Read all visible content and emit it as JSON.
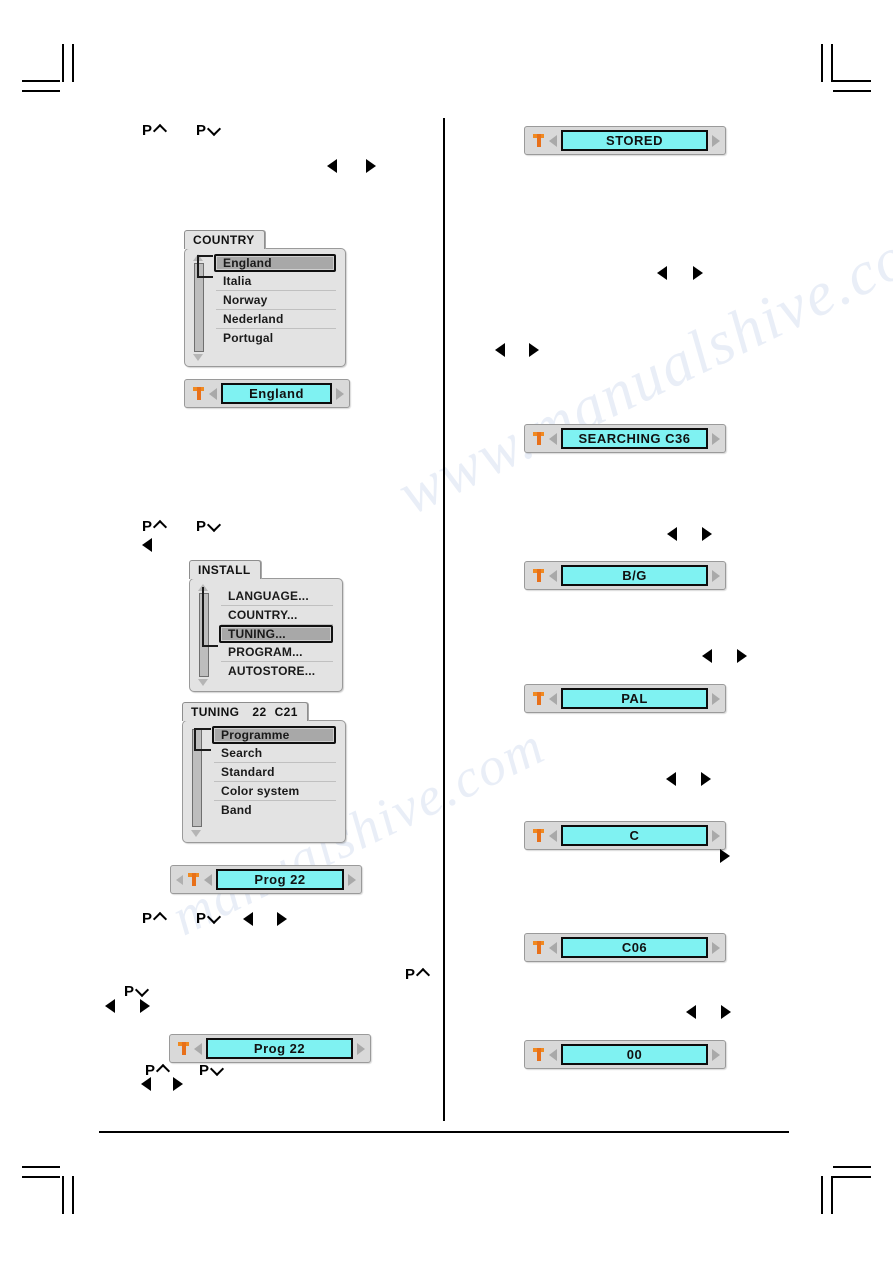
{
  "page": {
    "title": "TV installation menu manual page",
    "watermarks": [
      "www.manualshive.com",
      "manualshive.com"
    ]
  },
  "left_column": {
    "key_hints": [
      {
        "label": "P",
        "direction": "up"
      },
      {
        "label": "P",
        "direction": "down"
      }
    ],
    "country_menu": {
      "tab_label": "COUNTRY",
      "items": [
        {
          "label": "England",
          "selected": true
        },
        {
          "label": "Italia",
          "selected": false
        },
        {
          "label": "Norway",
          "selected": false
        },
        {
          "label": "Nederland",
          "selected": false
        },
        {
          "label": "Portugal",
          "selected": false
        }
      ],
      "status_bar": {
        "icon": "antenna-icon",
        "value": "England"
      }
    },
    "install_menu": {
      "tab_label": "INSTALL",
      "items": [
        {
          "label": "LANGUAGE...",
          "selected": false
        },
        {
          "label": "COUNTRY...",
          "selected": false
        },
        {
          "label": "TUNING...",
          "selected": true
        },
        {
          "label": "PROGRAM...",
          "selected": false
        },
        {
          "label": "AUTOSTORE...",
          "selected": false
        }
      ]
    },
    "tuning_menu": {
      "tab_label": "TUNING",
      "tab_program": "22",
      "tab_channel": "C21",
      "items": [
        {
          "label": "Programme",
          "selected": true
        },
        {
          "label": "Search",
          "selected": false
        },
        {
          "label": "Standard",
          "selected": false
        },
        {
          "label": "Color system",
          "selected": false
        },
        {
          "label": "Band",
          "selected": false
        }
      ],
      "status_bar": {
        "icon": "antenna-icon",
        "value": "Prog  22"
      }
    },
    "program_bar": {
      "icon": "antenna-icon",
      "value": "Prog  22"
    }
  },
  "right_column": {
    "bars": [
      {
        "icon": "antenna-icon",
        "value": "STORED"
      },
      {
        "icon": "antenna-icon",
        "value": "SEARCHING  C36"
      },
      {
        "icon": "antenna-icon",
        "value": "B/G"
      },
      {
        "icon": "antenna-icon",
        "value": "PAL"
      },
      {
        "icon": "antenna-icon",
        "value": "C"
      },
      {
        "icon": "antenna-icon",
        "value": "C06"
      },
      {
        "icon": "antenna-icon",
        "value": "00"
      }
    ]
  },
  "colors": {
    "osd_field": "#7ff2f2",
    "osd_panel": "#e3e3e3",
    "antenna": "#ec7a1c",
    "selected_row": "#a8a8a8"
  }
}
